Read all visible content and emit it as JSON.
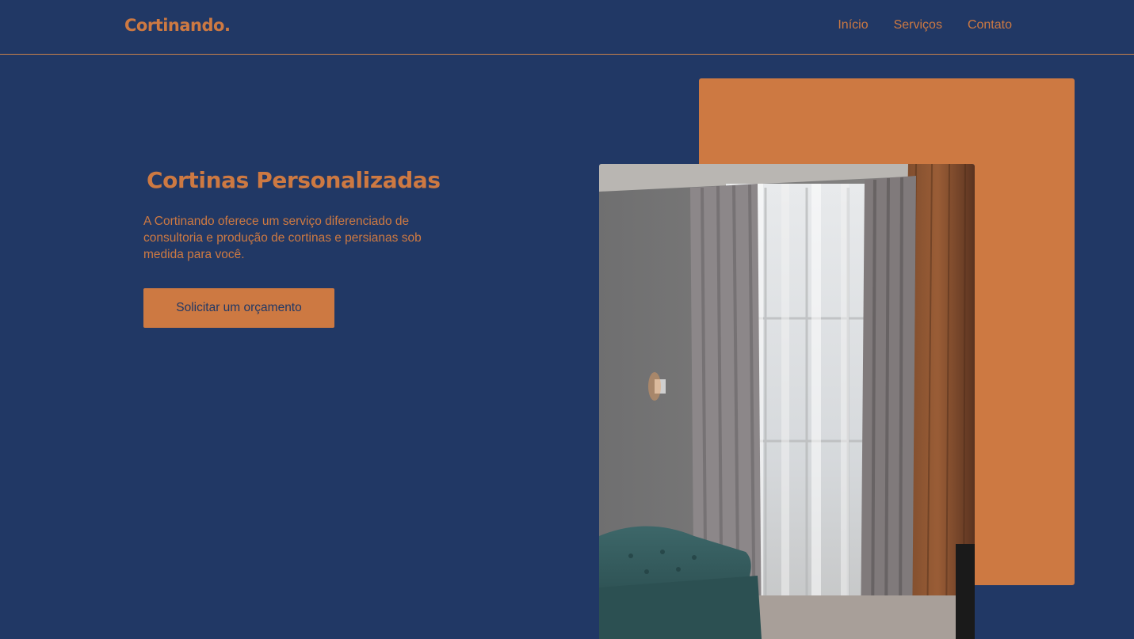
{
  "brand": {
    "logo": "Cortinando."
  },
  "nav": {
    "items": [
      "Início",
      "Serviços",
      "Contato"
    ]
  },
  "hero": {
    "title": "Cortinas Personalizadas",
    "description": "A Cortinando oferece um serviço diferenciado de consultoria e produção de cortinas e persianas sob medida para você.",
    "cta_label": "Solicitar um orçamento",
    "image_alt": "Sala com cortinas altas de voil e sofá verde"
  },
  "colors": {
    "background": "#213865",
    "accent": "#cd7942",
    "text_on_accent": "#213865"
  },
  "icons": {
    "logo": "wordmark"
  }
}
